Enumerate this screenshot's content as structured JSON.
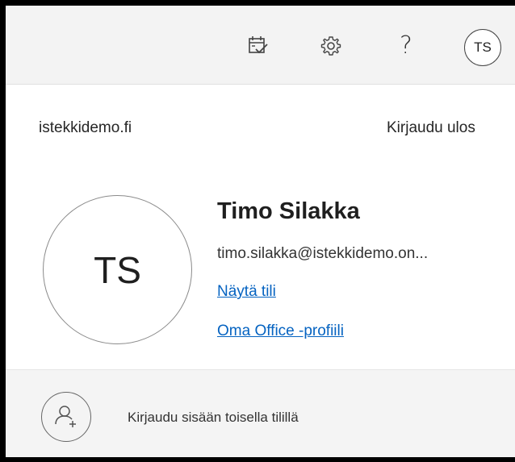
{
  "topbar": {
    "icons": [
      "calendar-check-icon",
      "gear-icon",
      "help-icon"
    ],
    "help_glyph": "?",
    "avatar_initials": "TS"
  },
  "account": {
    "tenant": "istekkidemo.fi",
    "sign_out_label": "Kirjaudu ulos",
    "avatar_initials": "TS",
    "name": "Timo Silakka",
    "email": "timo.silakka@istekkidemo.on...",
    "view_account_link": "Näytä tili",
    "office_profile_link": "Oma Office -profiili"
  },
  "add_account": {
    "icon": "add-person-icon",
    "label": "Kirjaudu sisään toisella tilillä"
  },
  "colors": {
    "link": "#0563c1",
    "topbar_bg": "#f3f3f3",
    "bottom_bg": "#f4f4f4"
  }
}
